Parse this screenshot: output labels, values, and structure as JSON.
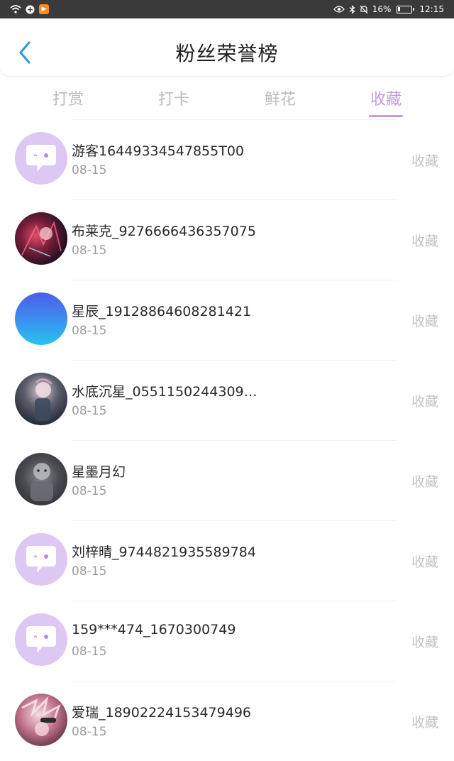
{
  "status_bar": {
    "battery_pct": "16%",
    "time": "12:15",
    "battery_level": 0.16
  },
  "header": {
    "title": "粉丝荣誉榜"
  },
  "tabs": [
    {
      "label": "打赏",
      "active": false
    },
    {
      "label": "打卡",
      "active": false
    },
    {
      "label": "鲜花",
      "active": false
    },
    {
      "label": "收藏",
      "active": true
    }
  ],
  "colors": {
    "accent": "#c39be6",
    "back_arrow": "#2f9be8"
  },
  "fans": [
    {
      "name": "游客16449334547855T00",
      "date": "08-15",
      "action": "收藏",
      "avatar": "default-chat-avatar"
    },
    {
      "name": "布莱克_9276666436357075",
      "date": "08-15",
      "action": "收藏",
      "avatar": "anime-avatar"
    },
    {
      "name": "星辰_19128864608281421",
      "date": "08-15",
      "action": "收藏",
      "avatar": "gradient-avatar"
    },
    {
      "name": "水底沉星_0551150244309…",
      "date": "08-15",
      "action": "收藏",
      "avatar": "anime-avatar"
    },
    {
      "name": "星墨月幻",
      "date": "08-15",
      "action": "收藏",
      "avatar": "anime-avatar"
    },
    {
      "name": "刘梓晴_9744821935589784",
      "date": "08-15",
      "action": "收藏",
      "avatar": "default-chat-avatar"
    },
    {
      "name": "159***474_1670300749",
      "date": "08-15",
      "action": "收藏",
      "avatar": "default-chat-avatar"
    },
    {
      "name": "爱瑞_18902224153479496",
      "date": "08-15",
      "action": "收藏",
      "avatar": "anime-avatar"
    }
  ]
}
